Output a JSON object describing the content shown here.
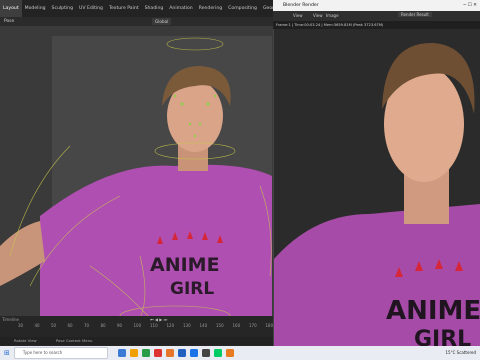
{
  "blender": {
    "workspaces": [
      "Layout",
      "Modeling",
      "Sculpting",
      "UV Editing",
      "Texture Paint",
      "Shading",
      "Animation",
      "Rendering",
      "Compositing",
      "Geometry Nodes",
      "Scripting"
    ],
    "active_workspace": "Layout",
    "mode": "Pose",
    "transform_orientation": "Global",
    "timeline_ticks": [
      "30",
      "40",
      "50",
      "60",
      "70",
      "80",
      "90",
      "100",
      "110",
      "120",
      "130",
      "140",
      "150",
      "160",
      "170",
      "180"
    ],
    "timeline_label": "Timeline",
    "status_left": "Rotate View",
    "status_mid": "Pose Context Menu"
  },
  "render_window": {
    "title": "Blender Render",
    "menu": [
      "View",
      "View",
      "Image"
    ],
    "slot": "Render Result",
    "info": "Frame:1 | Time:00:03.24 | Mem:3659.81M (Peak 3723.67M)"
  },
  "shirt_text": {
    "line1": "ANIME",
    "line2": "GIRL"
  },
  "taskbar": {
    "search_placeholder": "Type here to search",
    "weather": "15°C  Scattered",
    "colors": [
      "#3b7bd6",
      "#f0a000",
      "#2a9d48",
      "#d33",
      "#e6762a",
      "#2060c0",
      "#1a73e8",
      "#444",
      "#0c6",
      "#e87a20"
    ]
  }
}
